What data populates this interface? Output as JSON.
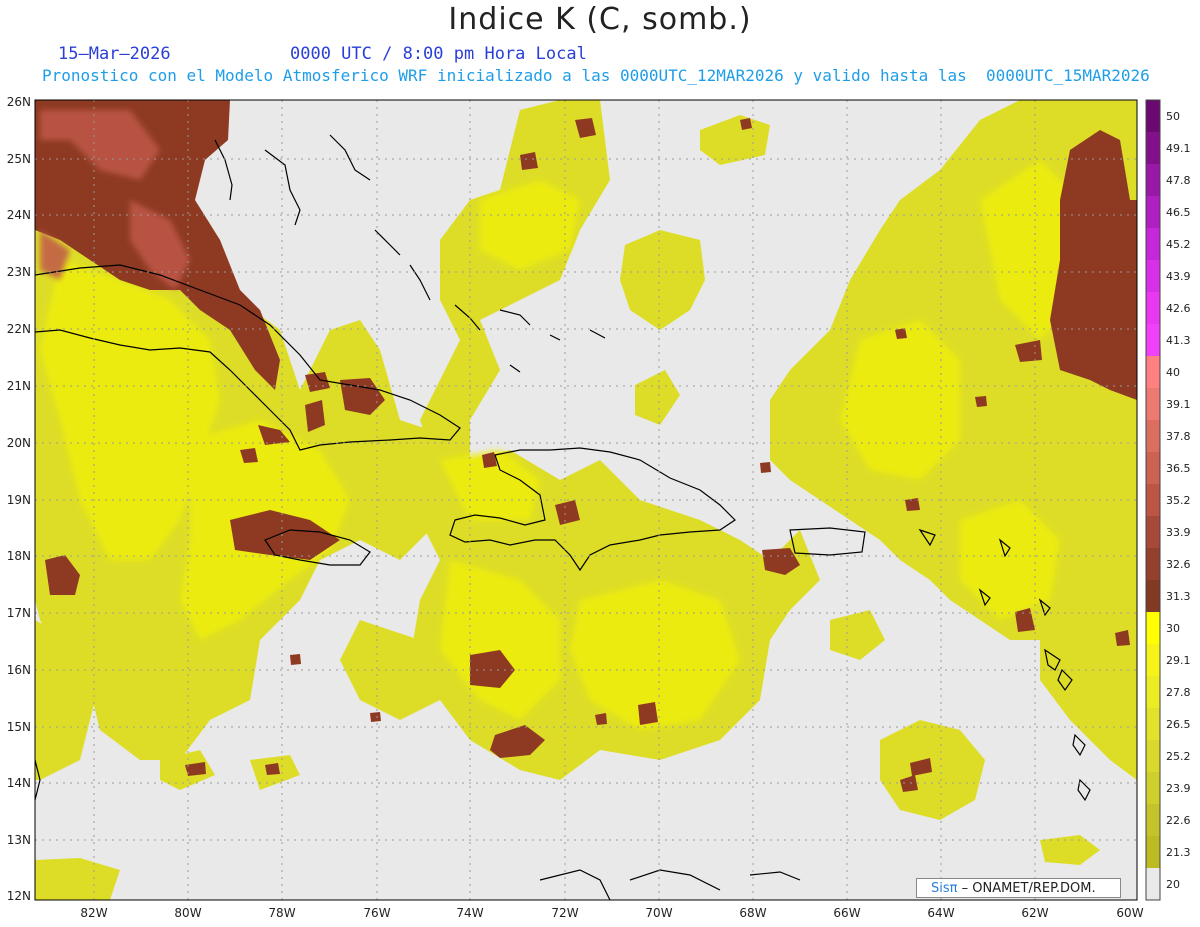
{
  "header": {
    "title": "Indice K (C, somb.)",
    "date": "15–Mar–2026",
    "time": "0000 UTC / 8:00 pm Hora Local",
    "description": "Pronostico con el Modelo Atmosferico WRF inicializado a las 0000UTC_12MAR2026 y valido hasta las  0000UTC_15MAR2026"
  },
  "map": {
    "lon_range": [
      -83,
      -60
    ],
    "lat_range": [
      12,
      26
    ],
    "lon_ticks": [
      "82W",
      "80W",
      "78W",
      "76W",
      "74W",
      "72W",
      "70W",
      "68W",
      "66W",
      "64W",
      "62W",
      "60W"
    ],
    "lat_ticks": [
      "12N",
      "13N",
      "14N",
      "15N",
      "16N",
      "17N",
      "18N",
      "19N",
      "20N",
      "21N",
      "22N",
      "23N",
      "24N",
      "25N",
      "26N"
    ],
    "background_color": "#e9e9e9",
    "coastline_color": "#000000"
  },
  "colorbar": {
    "levels": [
      "50",
      "49.1",
      "47.8",
      "46.5",
      "45.2",
      "43.9",
      "42.6",
      "41.3",
      "40",
      "39.1",
      "37.8",
      "36.5",
      "35.2",
      "33.9",
      "32.6",
      "31.3",
      "30",
      "29.1",
      "27.8",
      "26.5",
      "25.2",
      "23.9",
      "22.6",
      "21.3",
      "20"
    ],
    "colors": [
      "#6a0a70",
      "#82108a",
      "#9a18a8",
      "#b01fc2",
      "#c428d8",
      "#d830e8",
      "#e838f0",
      "#f040f8",
      "#ff8080",
      "#ec7a72",
      "#dc6e60",
      "#cc6252",
      "#bc5544",
      "#a8483a",
      "#94402f",
      "#833a25",
      "#ffff00",
      "#f6f318",
      "#ecec25",
      "#e2e22a",
      "#d8d82d",
      "#cece2c",
      "#c4c42a",
      "#bcbb22",
      "#e9e9e9"
    ]
  },
  "credit": {
    "logo_text": "Sisπ",
    "text": "– ONAMET/REP.DOM."
  }
}
